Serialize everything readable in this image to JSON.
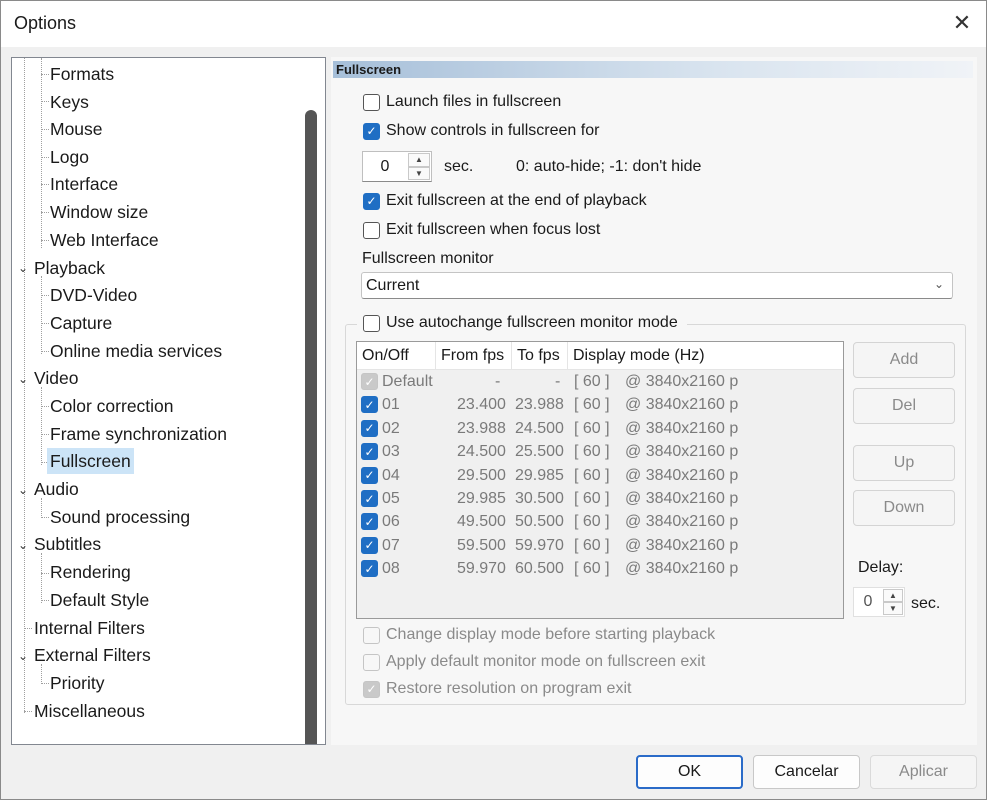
{
  "window": {
    "title": "Options"
  },
  "tree": {
    "items": [
      {
        "label": "Formats"
      },
      {
        "label": "Keys"
      },
      {
        "label": "Mouse"
      },
      {
        "label": "Logo"
      },
      {
        "label": "Interface"
      },
      {
        "label": "Window size"
      },
      {
        "label": "Web Interface"
      },
      {
        "label": "Playback"
      },
      {
        "label": "DVD-Video"
      },
      {
        "label": "Capture"
      },
      {
        "label": "Online media services"
      },
      {
        "label": "Video"
      },
      {
        "label": "Color correction"
      },
      {
        "label": "Frame synchronization"
      },
      {
        "label": "Fullscreen"
      },
      {
        "label": "Audio"
      },
      {
        "label": "Sound processing"
      },
      {
        "label": "Subtitles"
      },
      {
        "label": "Rendering"
      },
      {
        "label": "Default Style"
      },
      {
        "label": "Internal Filters"
      },
      {
        "label": "External Filters"
      },
      {
        "label": "Priority"
      },
      {
        "label": "Miscellaneous"
      }
    ]
  },
  "section": {
    "title": "Fullscreen"
  },
  "options": {
    "launch_fullscreen": "Launch files in fullscreen",
    "show_controls": "Show controls in fullscreen for",
    "controls_seconds": "0",
    "sec_label": "sec.",
    "hint": "0: auto-hide; -1: don't hide",
    "exit_end": "Exit fullscreen at the end of playback",
    "exit_focus": "Exit fullscreen when focus lost",
    "monitor_label": "Fullscreen monitor",
    "monitor_value": "Current",
    "autochange": "Use autochange fullscreen monitor mode"
  },
  "table": {
    "columns": [
      "On/Off",
      "From fps",
      "To fps",
      "Display mode (Hz)"
    ],
    "rows": [
      {
        "name": "Default",
        "from": "-",
        "to": "-",
        "hz": "[ 60 ]",
        "res": "@ 3840x2160 p"
      },
      {
        "name": "01",
        "from": "23.400",
        "to": "23.988",
        "hz": "[ 60 ]",
        "res": "@ 3840x2160 p"
      },
      {
        "name": "02",
        "from": "23.988",
        "to": "24.500",
        "hz": "[ 60 ]",
        "res": "@ 3840x2160 p"
      },
      {
        "name": "03",
        "from": "24.500",
        "to": "25.500",
        "hz": "[ 60 ]",
        "res": "@ 3840x2160 p"
      },
      {
        "name": "04",
        "from": "29.500",
        "to": "29.985",
        "hz": "[ 60 ]",
        "res": "@ 3840x2160 p"
      },
      {
        "name": "05",
        "from": "29.985",
        "to": "30.500",
        "hz": "[ 60 ]",
        "res": "@ 3840x2160 p"
      },
      {
        "name": "06",
        "from": "49.500",
        "to": "50.500",
        "hz": "[ 60 ]",
        "res": "@ 3840x2160 p"
      },
      {
        "name": "07",
        "from": "59.500",
        "to": "59.970",
        "hz": "[ 60 ]",
        "res": "@ 3840x2160 p"
      },
      {
        "name": "08",
        "from": "59.970",
        "to": "60.500",
        "hz": "[ 60 ]",
        "res": "@ 3840x2160 p"
      }
    ]
  },
  "side_buttons": {
    "add": "Add",
    "del": "Del",
    "up": "Up",
    "down": "Down"
  },
  "delay": {
    "label": "Delay:",
    "value": "0",
    "unit": "sec."
  },
  "bottom_options": {
    "change_mode": "Change display mode before starting playback",
    "apply_default": "Apply default monitor mode on fullscreen exit",
    "restore_res": "Restore resolution on program exit"
  },
  "footer": {
    "ok": "OK",
    "cancel": "Cancelar",
    "apply": "Aplicar"
  }
}
